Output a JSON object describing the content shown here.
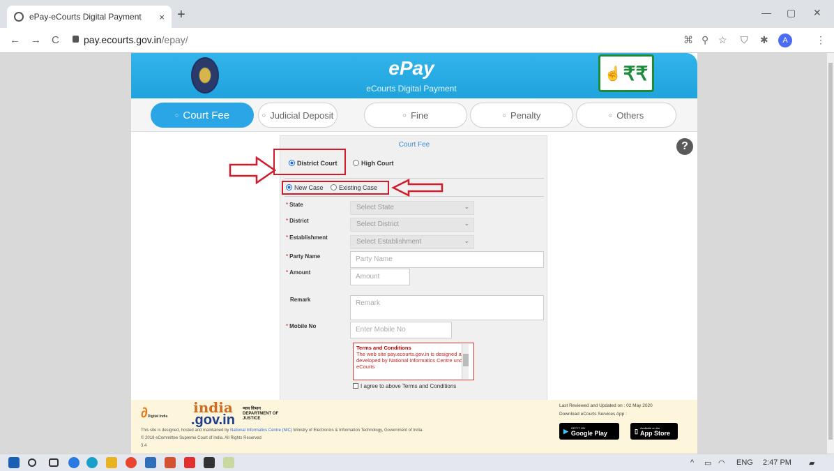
{
  "browser": {
    "tab_title": "ePay-eCourts Digital Payment",
    "tab_close": "×",
    "new_tab": "+",
    "url_host": "pay.ecourts.gov.in",
    "url_path": "/epay/",
    "back": "←",
    "forward": "→",
    "reload": "C",
    "win_min": "—",
    "win_max": "▢",
    "win_close": "✕",
    "ext1": "⌘",
    "ext2": "⚲",
    "ext3": "☆",
    "ext4": "⛉",
    "ext5": "✱",
    "profile_initial": "A",
    "menu": "⋮"
  },
  "header": {
    "title": "ePay",
    "subtitle": "eCourts Digital Payment",
    "pay_logo": "₹₹"
  },
  "payment_tabs": [
    {
      "label": "Court Fee",
      "active": true
    },
    {
      "label": "Judicial Deposit",
      "active": false
    },
    {
      "label": "Fine",
      "active": false
    },
    {
      "label": "Penalty",
      "active": false
    },
    {
      "label": "Others",
      "active": false
    }
  ],
  "help_icon": "?",
  "form": {
    "title": "Court Fee",
    "court_options": [
      "District Court",
      "High Court"
    ],
    "case_options": [
      "New Case",
      "Existing Case"
    ],
    "required_mark": "*",
    "fields": {
      "state_label": "State",
      "state_value": "Select State",
      "district_label": "District",
      "district_value": "Select District",
      "establishment_label": "Establishment",
      "establishment_value": "Select Establishment",
      "party_label": "Party Name",
      "party_placeholder": "Party Name",
      "amount_label": "Amount",
      "amount_placeholder": "Amount",
      "remark_label": "Remark",
      "remark_placeholder": "Remark",
      "mobile_label": "Mobile No",
      "mobile_placeholder": "Enter Mobile No"
    },
    "terms_heading": "Terms and Conditions",
    "terms_text": "The web site pay.ecourts.gov.in is designed and developed by National Informatics Centre under eCourts",
    "agree_label": "I agree to above Terms and Conditions"
  },
  "footer": {
    "digital_india": "Digital India",
    "india_gov_1": "india",
    "india_gov_2": ".gov.in",
    "doj_hindi": "न्याय विभाग",
    "doj_1": "DEPARTMENT OF",
    "doj_2": "JUSTICE",
    "line1_a": "This site is designed, hosted and maintained by ",
    "line1_link": "National Informatics Centre (NIC)",
    "line1_b": " Ministry of Electronics & Information Technology, Government of India.",
    "line2": "© 2018 eCommittee Supreme Court of India. All Rights Reserved",
    "line3": "3.4",
    "last_reviewed": "Last Reviewed and Updated on : 02 May 2020",
    "download_app": "Download eCourts Services App :",
    "google_small": "GET IT ON",
    "google_play": "Google Play",
    "apple_small": "Available on the",
    "app_store": "App Store"
  },
  "taskbar": {
    "tray_up": "^",
    "lang": "ENG",
    "time": "2:47 PM"
  }
}
